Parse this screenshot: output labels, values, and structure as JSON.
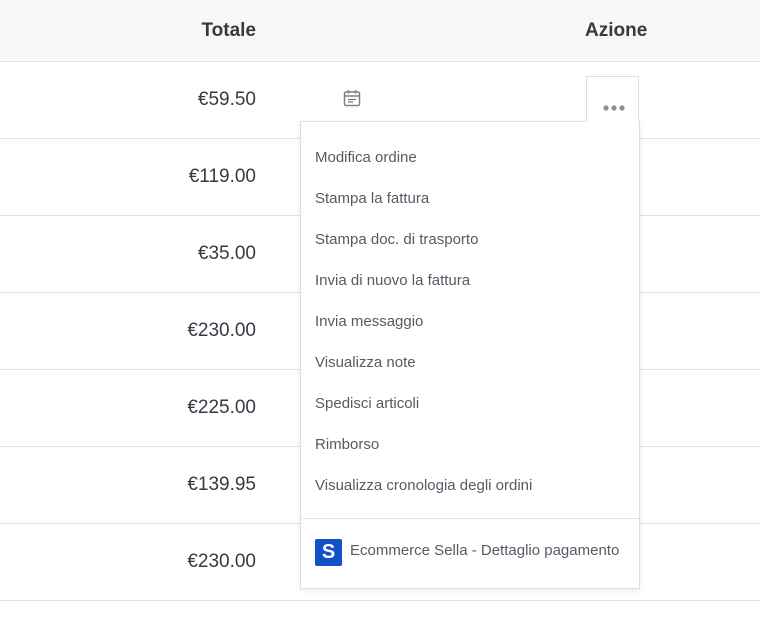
{
  "header": {
    "totale": "Totale",
    "azione": "Azione"
  },
  "rows": [
    {
      "total": "€59.50"
    },
    {
      "total": "€119.00"
    },
    {
      "total": "€35.00"
    },
    {
      "total": "€230.00"
    },
    {
      "total": "€225.00"
    },
    {
      "total": "€139.95"
    },
    {
      "total": "€230.00"
    }
  ],
  "icons": {
    "calendar": "calendar-icon",
    "more": "more-dots-icon",
    "sella_logo": "sella-logo"
  },
  "action_menu": {
    "items": [
      "Modifica ordine",
      "Stampa la fattura",
      "Stampa doc. di trasporto",
      "Invia di nuovo la fattura",
      "Invia messaggio",
      "Visualizza note",
      "Spedisci articoli",
      "Rimborso",
      "Visualizza cronologia degli ordini"
    ],
    "payment_detail": {
      "logo_letter": "S",
      "label": "Ecommerce Sella - Dettaglio pagamento"
    }
  },
  "colors": {
    "text": "#363a43",
    "menu_text": "#555a64",
    "sella_blue": "#1550c8",
    "border": "#e3e3e3"
  }
}
